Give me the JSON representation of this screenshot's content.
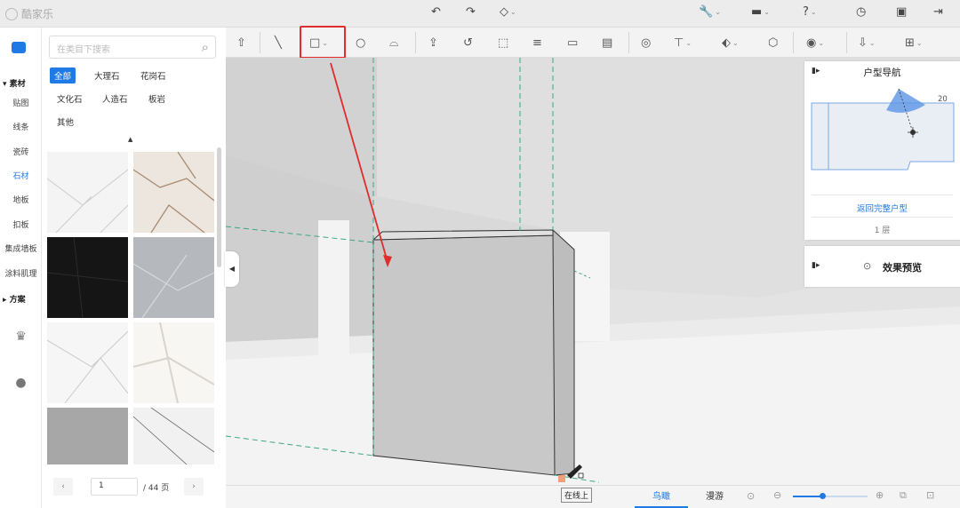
{
  "app": {
    "name": "酷家乐"
  },
  "materials": {
    "search_placeholder": "在类目下搜索",
    "categories": [
      {
        "label": "全部",
        "selected": true
      },
      {
        "label": "大理石",
        "selected": false
      },
      {
        "label": "花岗石",
        "selected": false
      },
      {
        "label": "文化石",
        "selected": false
      },
      {
        "label": "人造石",
        "selected": false
      },
      {
        "label": "板岩",
        "selected": false
      },
      {
        "label": "其他",
        "selected": false
      }
    ],
    "page": {
      "current": "1",
      "total": "/ 44 页"
    }
  },
  "sidebar": {
    "group_material": "素材",
    "items": [
      "贴图",
      "线条",
      "瓷砖",
      "石材",
      "地板",
      "扣板",
      "集成墙板",
      "涂料肌理"
    ],
    "active_item": "石材",
    "group_plan": "方案"
  },
  "navigator": {
    "title": "户型导航",
    "angle": "20",
    "back_link": "返回完整户型",
    "floor": "1 层"
  },
  "preview": {
    "title": "效果预览"
  },
  "statusbar": {
    "view_birdseye": "鸟瞰",
    "view_roam": "漫游",
    "tooltip": "在线上"
  },
  "colors": {
    "accent": "#1f7ae6",
    "highlight": "#e02c2c",
    "guide": "#3da58a"
  }
}
